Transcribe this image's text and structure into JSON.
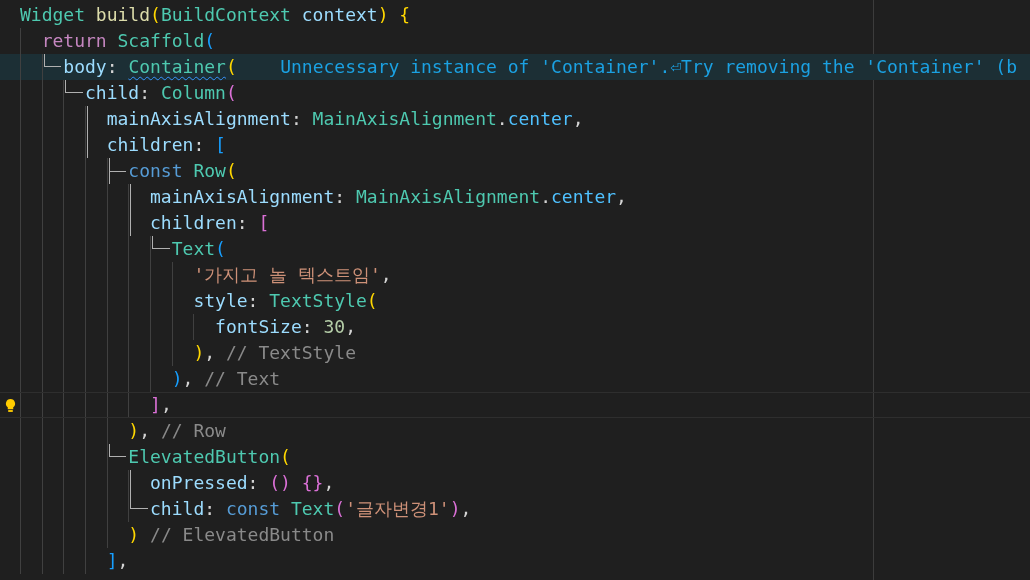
{
  "editor": {
    "lines": [
      {
        "tokens": [
          {
            "kind": "type",
            "text": "Widget "
          },
          {
            "kind": "function",
            "text": "build"
          },
          {
            "kind": "bracket",
            "text": "(",
            "color": "#ffd700"
          },
          {
            "kind": "type",
            "text": "BuildContext "
          },
          {
            "kind": "prop",
            "text": "context"
          },
          {
            "kind": "bracket",
            "text": ")",
            "color": "#ffd700"
          },
          {
            "kind": "bracket",
            "text": " {",
            "color": "#ffd700"
          }
        ]
      },
      {
        "tokens": [
          {
            "kind": "control",
            "text": "  return "
          },
          {
            "kind": "type",
            "text": "Scaffold"
          },
          {
            "kind": "bracket",
            "text": "(",
            "color": "#179fff"
          }
        ]
      },
      {
        "outline": {
          "kind": "elbow"
        },
        "highlight": true,
        "tokens": [
          {
            "kind": "prop",
            "text": "    body"
          },
          {
            "kind": "plain",
            "text": ": "
          },
          {
            "kind": "type",
            "text": "Container",
            "squiggle": true
          },
          {
            "kind": "bracket",
            "text": "(",
            "color": "#ffd700"
          }
        ],
        "hint": "Unnecessary instance of 'Container'.⏎Try removing the 'Container' (b"
      },
      {
        "outline": {
          "kind": "elbow"
        },
        "tokens": [
          {
            "kind": "prop",
            "text": "      child"
          },
          {
            "kind": "plain",
            "text": ": "
          },
          {
            "kind": "type",
            "text": "Column"
          },
          {
            "kind": "bracket",
            "text": "(",
            "color": "#da70d6"
          }
        ]
      },
      {
        "outline": {
          "kind": "bar"
        },
        "tokens": [
          {
            "kind": "prop",
            "text": "        mainAxisAlignment"
          },
          {
            "kind": "plain",
            "text": ": "
          },
          {
            "kind": "type",
            "text": "MainAxisAlignment"
          },
          {
            "kind": "plain",
            "text": "."
          },
          {
            "kind": "constant",
            "text": "center"
          },
          {
            "kind": "plain",
            "text": ","
          }
        ]
      },
      {
        "outline": {
          "kind": "bar"
        },
        "tokens": [
          {
            "kind": "prop",
            "text": "        children"
          },
          {
            "kind": "plain",
            "text": ": "
          },
          {
            "kind": "bracket",
            "text": "[",
            "color": "#179fff"
          }
        ]
      },
      {
        "outline": {
          "kind": "tee"
        },
        "tokens": [
          {
            "kind": "keyword",
            "text": "          const "
          },
          {
            "kind": "type",
            "text": "Row"
          },
          {
            "kind": "bracket",
            "text": "(",
            "color": "#ffd700"
          }
        ]
      },
      {
        "outline": {
          "kind": "bar"
        },
        "tokens": [
          {
            "kind": "prop",
            "text": "            mainAxisAlignment"
          },
          {
            "kind": "plain",
            "text": ": "
          },
          {
            "kind": "type",
            "text": "MainAxisAlignment"
          },
          {
            "kind": "plain",
            "text": "."
          },
          {
            "kind": "constant",
            "text": "center"
          },
          {
            "kind": "plain",
            "text": ","
          }
        ]
      },
      {
        "outline": {
          "kind": "bar"
        },
        "tokens": [
          {
            "kind": "prop",
            "text": "            children"
          },
          {
            "kind": "plain",
            "text": ": "
          },
          {
            "kind": "bracket",
            "text": "[",
            "color": "#da70d6"
          }
        ]
      },
      {
        "outline": {
          "kind": "elbow"
        },
        "tokens": [
          {
            "kind": "type",
            "text": "              Text"
          },
          {
            "kind": "bracket",
            "text": "(",
            "color": "#179fff"
          }
        ]
      },
      {
        "tokens": [
          {
            "kind": "string",
            "text": "                '가지고 놀 텍스트임'"
          },
          {
            "kind": "plain",
            "text": ","
          }
        ]
      },
      {
        "tokens": [
          {
            "kind": "prop",
            "text": "                style"
          },
          {
            "kind": "plain",
            "text": ": "
          },
          {
            "kind": "type",
            "text": "TextStyle"
          },
          {
            "kind": "bracket",
            "text": "(",
            "color": "#ffd700"
          }
        ]
      },
      {
        "tokens": [
          {
            "kind": "prop",
            "text": "                  fontSize"
          },
          {
            "kind": "plain",
            "text": ": "
          },
          {
            "kind": "number",
            "text": "30"
          },
          {
            "kind": "plain",
            "text": ","
          }
        ]
      },
      {
        "tokens": [
          {
            "kind": "bracket",
            "text": "                )",
            "color": "#ffd700"
          },
          {
            "kind": "plain",
            "text": ", "
          },
          {
            "kind": "label",
            "text": "// TextStyle"
          }
        ]
      },
      {
        "tokens": [
          {
            "kind": "bracket",
            "text": "              )",
            "color": "#179fff"
          },
          {
            "kind": "plain",
            "text": ", "
          },
          {
            "kind": "label",
            "text": "// Text"
          }
        ]
      },
      {
        "current": true,
        "lightbulb": true,
        "tokens": [
          {
            "kind": "bracket",
            "text": "            ]",
            "color": "#da70d6"
          },
          {
            "kind": "plain",
            "text": ","
          }
        ]
      },
      {
        "tokens": [
          {
            "kind": "bracket",
            "text": "          )",
            "color": "#ffd700"
          },
          {
            "kind": "plain",
            "text": ", "
          },
          {
            "kind": "label",
            "text": "// Row"
          }
        ]
      },
      {
        "outline": {
          "kind": "elbow"
        },
        "tokens": [
          {
            "kind": "type",
            "text": "          ElevatedButton"
          },
          {
            "kind": "bracket",
            "text": "(",
            "color": "#ffd700"
          }
        ]
      },
      {
        "outline": {
          "kind": "bar"
        },
        "tokens": [
          {
            "kind": "prop",
            "text": "            onPressed"
          },
          {
            "kind": "plain",
            "text": ": "
          },
          {
            "kind": "bracket",
            "text": "() {}",
            "color": "#da70d6"
          },
          {
            "kind": "plain",
            "text": ","
          }
        ]
      },
      {
        "outline": {
          "kind": "elbow"
        },
        "tokens": [
          {
            "kind": "prop",
            "text": "            child"
          },
          {
            "kind": "plain",
            "text": ": "
          },
          {
            "kind": "keyword",
            "text": "const "
          },
          {
            "kind": "type",
            "text": "Text"
          },
          {
            "kind": "bracket",
            "text": "(",
            "color": "#da70d6"
          },
          {
            "kind": "string",
            "text": "'글자변경1'"
          },
          {
            "kind": "bracket",
            "text": ")",
            "color": "#da70d6"
          },
          {
            "kind": "plain",
            "text": ","
          }
        ]
      },
      {
        "tokens": [
          {
            "kind": "bracket",
            "text": "          )",
            "color": "#ffd700"
          },
          {
            "kind": "label",
            "text": " // ElevatedButton"
          }
        ]
      },
      {
        "tokens": [
          {
            "kind": "bracket",
            "text": "        ]",
            "color": "#179fff"
          },
          {
            "kind": "plain",
            "text": ","
          }
        ]
      }
    ]
  }
}
